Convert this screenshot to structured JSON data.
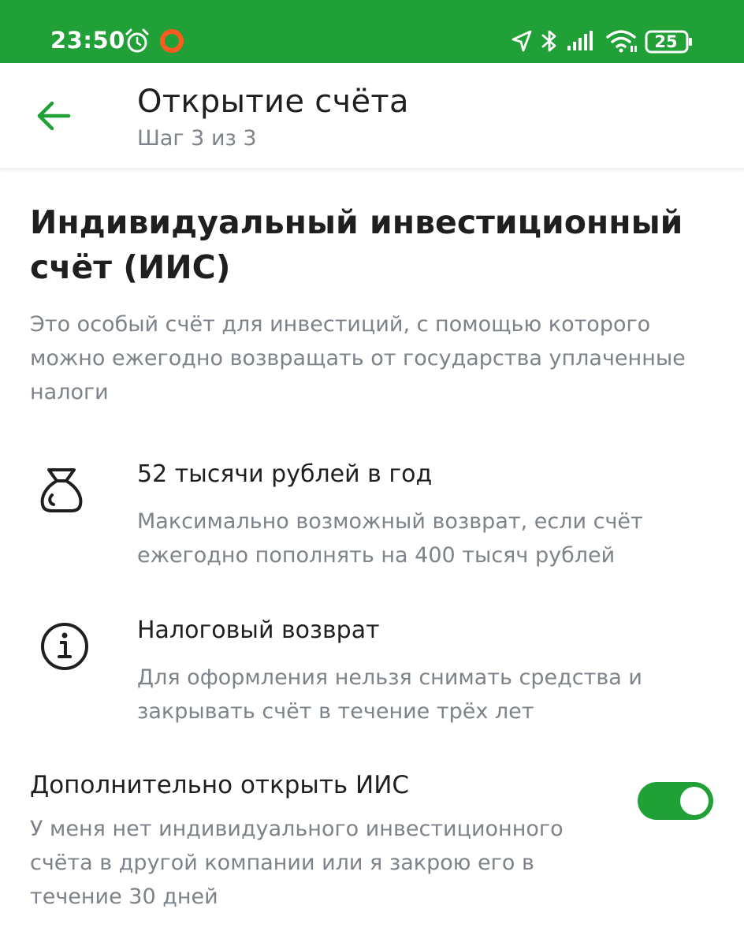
{
  "status_bar": {
    "time": "23:50",
    "battery": "25",
    "icons": [
      "alarm-icon",
      "ring-icon",
      "location-arrow-icon",
      "bluetooth-icon",
      "signal-icon",
      "wifi-icon",
      "battery-icon"
    ]
  },
  "header": {
    "back_icon": "arrow-left-icon",
    "title": "Открытие счёта",
    "subtitle": "Шаг 3 из 3"
  },
  "main": {
    "title": "Индивидуальный инвестиционный счёт (ИИС)",
    "description": "Это особый счёт для инвестиций, с помощью которого можно ежегодно возвращать от государства уплаченные налоги"
  },
  "features": [
    {
      "icon": "money-bag-icon",
      "title": "52 тысячи рублей в год",
      "description": "Максимально возможный возврат, если счёт ежегодно пополнять на 400 тысяч рублей"
    },
    {
      "icon": "info-icon",
      "title": "Налоговый возврат",
      "description": "Для оформления нельзя снимать средства и закрывать счёт в течение трёх лет"
    }
  ],
  "option": {
    "title": "Дополнительно открыть ИИС",
    "description": "У меня нет индивидуального инвестиционного счёта в другой компании или я закрою его в течение 30 дней",
    "toggle_on": true
  },
  "colors": {
    "brand_green": "#21a038",
    "text_primary": "#1f1f22",
    "text_secondary": "#7d838a",
    "ring_orange": "#ff5a1f"
  }
}
